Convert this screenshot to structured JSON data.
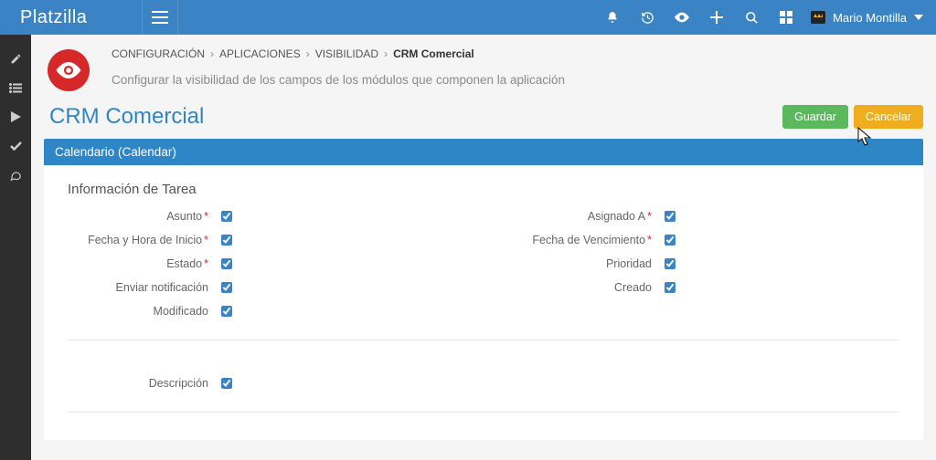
{
  "brand": "Platzilla",
  "user": {
    "name": "Mario Montilla"
  },
  "breadcrumb": {
    "items": [
      "CONFIGURACIÓN",
      "APLICACIONES",
      "VISIBILIDAD"
    ],
    "current": "CRM Comercial"
  },
  "subtitle": "Configurar la visibilidad de los campos de los módulos que componen la aplicación",
  "page_title": "CRM Comercial",
  "buttons": {
    "save": "Guardar",
    "cancel": "Cancelar"
  },
  "section": {
    "label": "Calendario (Calendar)"
  },
  "group_title": "Información de Tarea",
  "fields": {
    "asunto": {
      "label": "Asunto",
      "required": true,
      "checked": true
    },
    "asignado": {
      "label": "Asignado A",
      "required": true,
      "checked": true
    },
    "fecha_inicio": {
      "label": "Fecha y Hora de Inicio",
      "required": true,
      "checked": true
    },
    "fecha_venc": {
      "label": "Fecha de Vencimiento",
      "required": true,
      "checked": true
    },
    "estado": {
      "label": "Estado",
      "required": true,
      "checked": true
    },
    "prioridad": {
      "label": "Prioridad",
      "required": false,
      "checked": true
    },
    "enviar_notif": {
      "label": "Enviar notificación",
      "required": false,
      "checked": true
    },
    "creado": {
      "label": "Creado",
      "required": false,
      "checked": true
    },
    "modificado": {
      "label": "Modificado",
      "required": false,
      "checked": true
    },
    "descripcion": {
      "label": "Descripción",
      "required": false,
      "checked": true
    }
  }
}
